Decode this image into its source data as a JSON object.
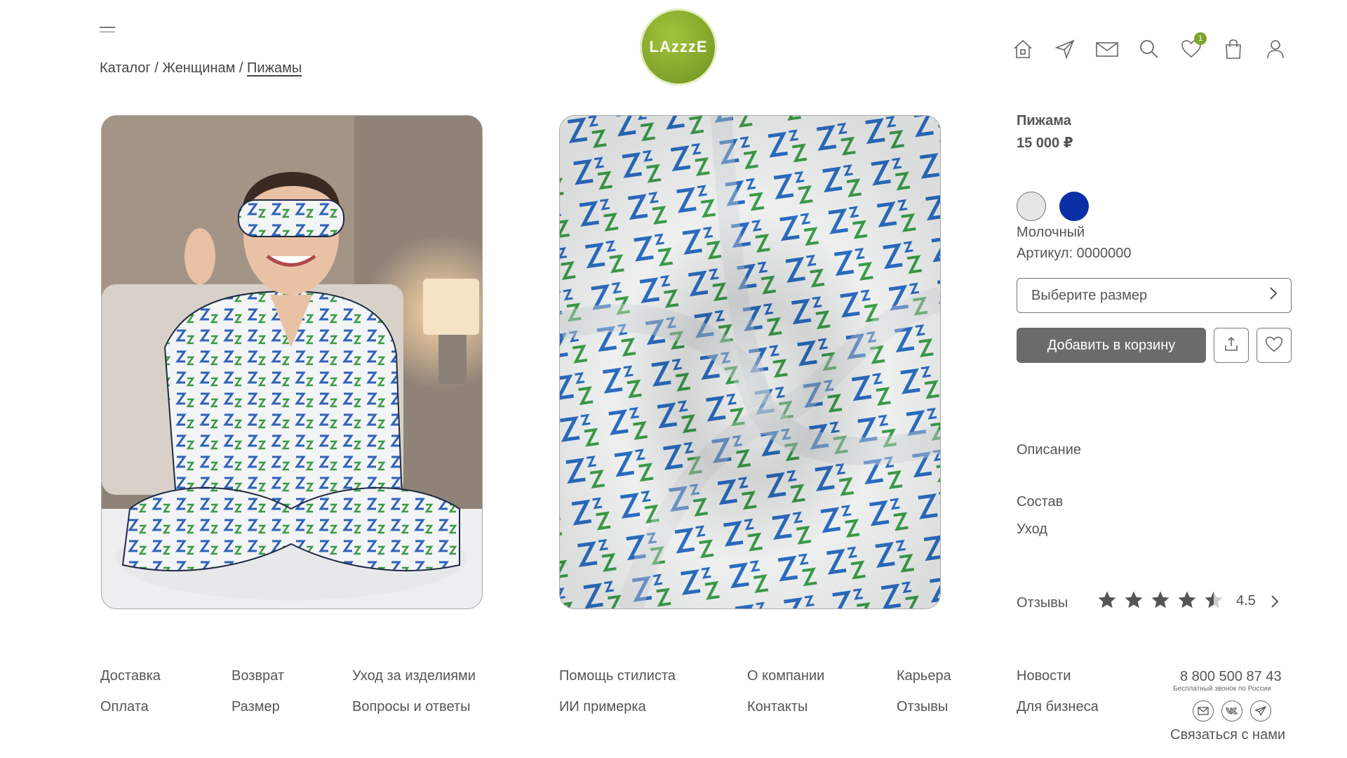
{
  "header": {
    "breadcrumb": {
      "item1": "Каталог",
      "sep": "/",
      "item2": "Женщинам",
      "item3": "Пижамы"
    },
    "logo_text": "LAzzzE",
    "favorites_count": "1"
  },
  "product": {
    "title": "Пижама",
    "price": "15 000 ₽",
    "colors": [
      {
        "name": "Молочный",
        "hex": "#e6e6e6"
      },
      {
        "hex": "#0a2ea5"
      }
    ],
    "selected_color": "Молочный",
    "sku": "Артикул: 0000000",
    "size_placeholder": "Выберите размер",
    "add_to_cart": "Добавить в корзину",
    "sections": [
      "Описание",
      "Состав",
      "Уход"
    ],
    "reviews_label": "Отзывы",
    "rating": "4.5"
  },
  "footer": {
    "col1": [
      "Доставка",
      "Оплата"
    ],
    "col2": [
      "Возврат",
      "Размер"
    ],
    "col3": [
      "Уход за изделиями",
      "Вопросы и ответы"
    ],
    "col4": [
      "Помощь стилиста",
      "ИИ примерка"
    ],
    "col5": [
      "О компании",
      "Контакты"
    ],
    "col6": [
      "Карьера",
      "Отзывы"
    ],
    "col7": [
      "Новости",
      "Для бизнеса"
    ],
    "phone": "8 800 500 87 43",
    "phone_note": "Бесплатный звонок по России",
    "contact": "Связаться с нами"
  },
  "colors": {
    "accent": "#7ca52a",
    "button": "#6b6b6b",
    "text": "#555555"
  }
}
